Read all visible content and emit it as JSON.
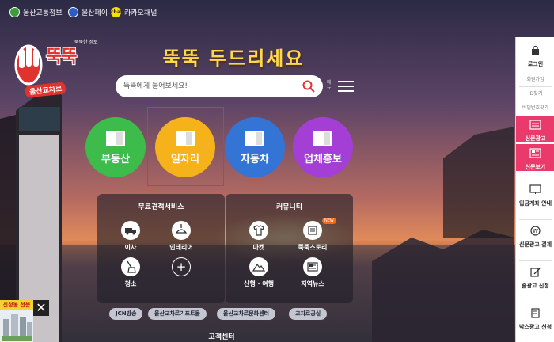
{
  "topbar": {
    "links": [
      {
        "label": "울산교통정보",
        "icon": "leaf-icon"
      },
      {
        "label": "울산페이",
        "icon": "pay-icon"
      },
      {
        "label": "카카오채널",
        "icon": "kakao-icon",
        "icon_text": "chat"
      }
    ]
  },
  "logo": {
    "main": "뚝뚝",
    "small": "뚝뚝한 정보",
    "sub": "울산교차로"
  },
  "headline": "뚝뚝 두드리세요",
  "search": {
    "placeholder": "뚝뚝에게 물어보세요!"
  },
  "menu_label": "메뉴",
  "categories": [
    {
      "label": "부동산",
      "color": "#3dbb4b"
    },
    {
      "label": "일자리",
      "color": "#f6b21a"
    },
    {
      "label": "자동차",
      "color": "#3474d4"
    },
    {
      "label": "업체홍보",
      "color": "#a43fd6"
    }
  ],
  "panels": {
    "left": {
      "title": "무료견적서비스",
      "items": [
        "이사",
        "인테리어",
        "청소",
        "+"
      ]
    },
    "right": {
      "title": "커뮤니티",
      "items": [
        "마켓",
        "뚝뚝스토리",
        "산행 · 여행",
        "지역뉴스"
      ],
      "new_badge": "NEW"
    }
  },
  "footer_links": [
    "JCN방송",
    "울산교차로기프트몰",
    "울산교차로문화센터",
    "교차로공실"
  ],
  "customer_center": "고객센터",
  "ad": {
    "title": "신정동 전문"
  },
  "sidebar": {
    "login": "로그인",
    "signup": "회원가입",
    "find_id": "ID찾기",
    "find_pw": "비밀번호찾기",
    "newspaper_ad": "신문광고",
    "newspaper_view": "신문보기",
    "deposit": "입금계좌 안내",
    "pay": "신문광고 결제",
    "ad_apply": "줄광고 신청",
    "box_ad": "박스광고 신청"
  },
  "colors": {
    "accent_pink": "#ea3a6c",
    "logo_red": "#e0322e",
    "headline_yellow": "#ffd94a"
  }
}
